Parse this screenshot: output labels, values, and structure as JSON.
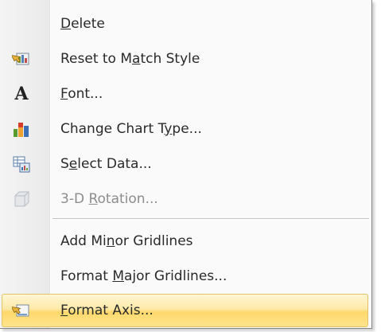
{
  "menu": {
    "items": [
      {
        "label_pre": "",
        "label_key": "D",
        "label_post": "elete",
        "icon": "none",
        "disabled": false
      },
      {
        "label_pre": "Reset to M",
        "label_key": "a",
        "label_post": "tch Style",
        "icon": "reset-style-icon",
        "disabled": false
      },
      {
        "label_pre": "",
        "label_key": "F",
        "label_post": "ont...",
        "icon": "font-icon",
        "icon_glyph": "A",
        "disabled": false
      },
      {
        "label_pre": "Change Chart T",
        "label_key": "y",
        "label_post": "pe...",
        "icon": "chart-type-icon",
        "disabled": false
      },
      {
        "label_pre": "S",
        "label_key": "e",
        "label_post": "lect Data...",
        "icon": "select-data-icon",
        "disabled": false
      },
      {
        "label_pre": "3-D ",
        "label_key": "R",
        "label_post": "otation...",
        "icon": "3d-rotation-icon",
        "disabled": true
      },
      {
        "label_pre": "Add Mi",
        "label_key": "n",
        "label_post": "or Gridlines",
        "icon": "none",
        "disabled": false
      },
      {
        "label_pre": "Format ",
        "label_key": "M",
        "label_post": "ajor Gridlines...",
        "icon": "none",
        "disabled": false
      },
      {
        "label_pre": "",
        "label_key": "F",
        "label_post": "ormat Axis...",
        "icon": "format-axis-icon",
        "disabled": false,
        "highlighted": true
      }
    ]
  },
  "colors": {
    "highlight_top": "#fff6d4",
    "highlight_bottom": "#ffd86b",
    "highlight_border": "#e5c365",
    "disabled_text": "#8d8d8d"
  }
}
